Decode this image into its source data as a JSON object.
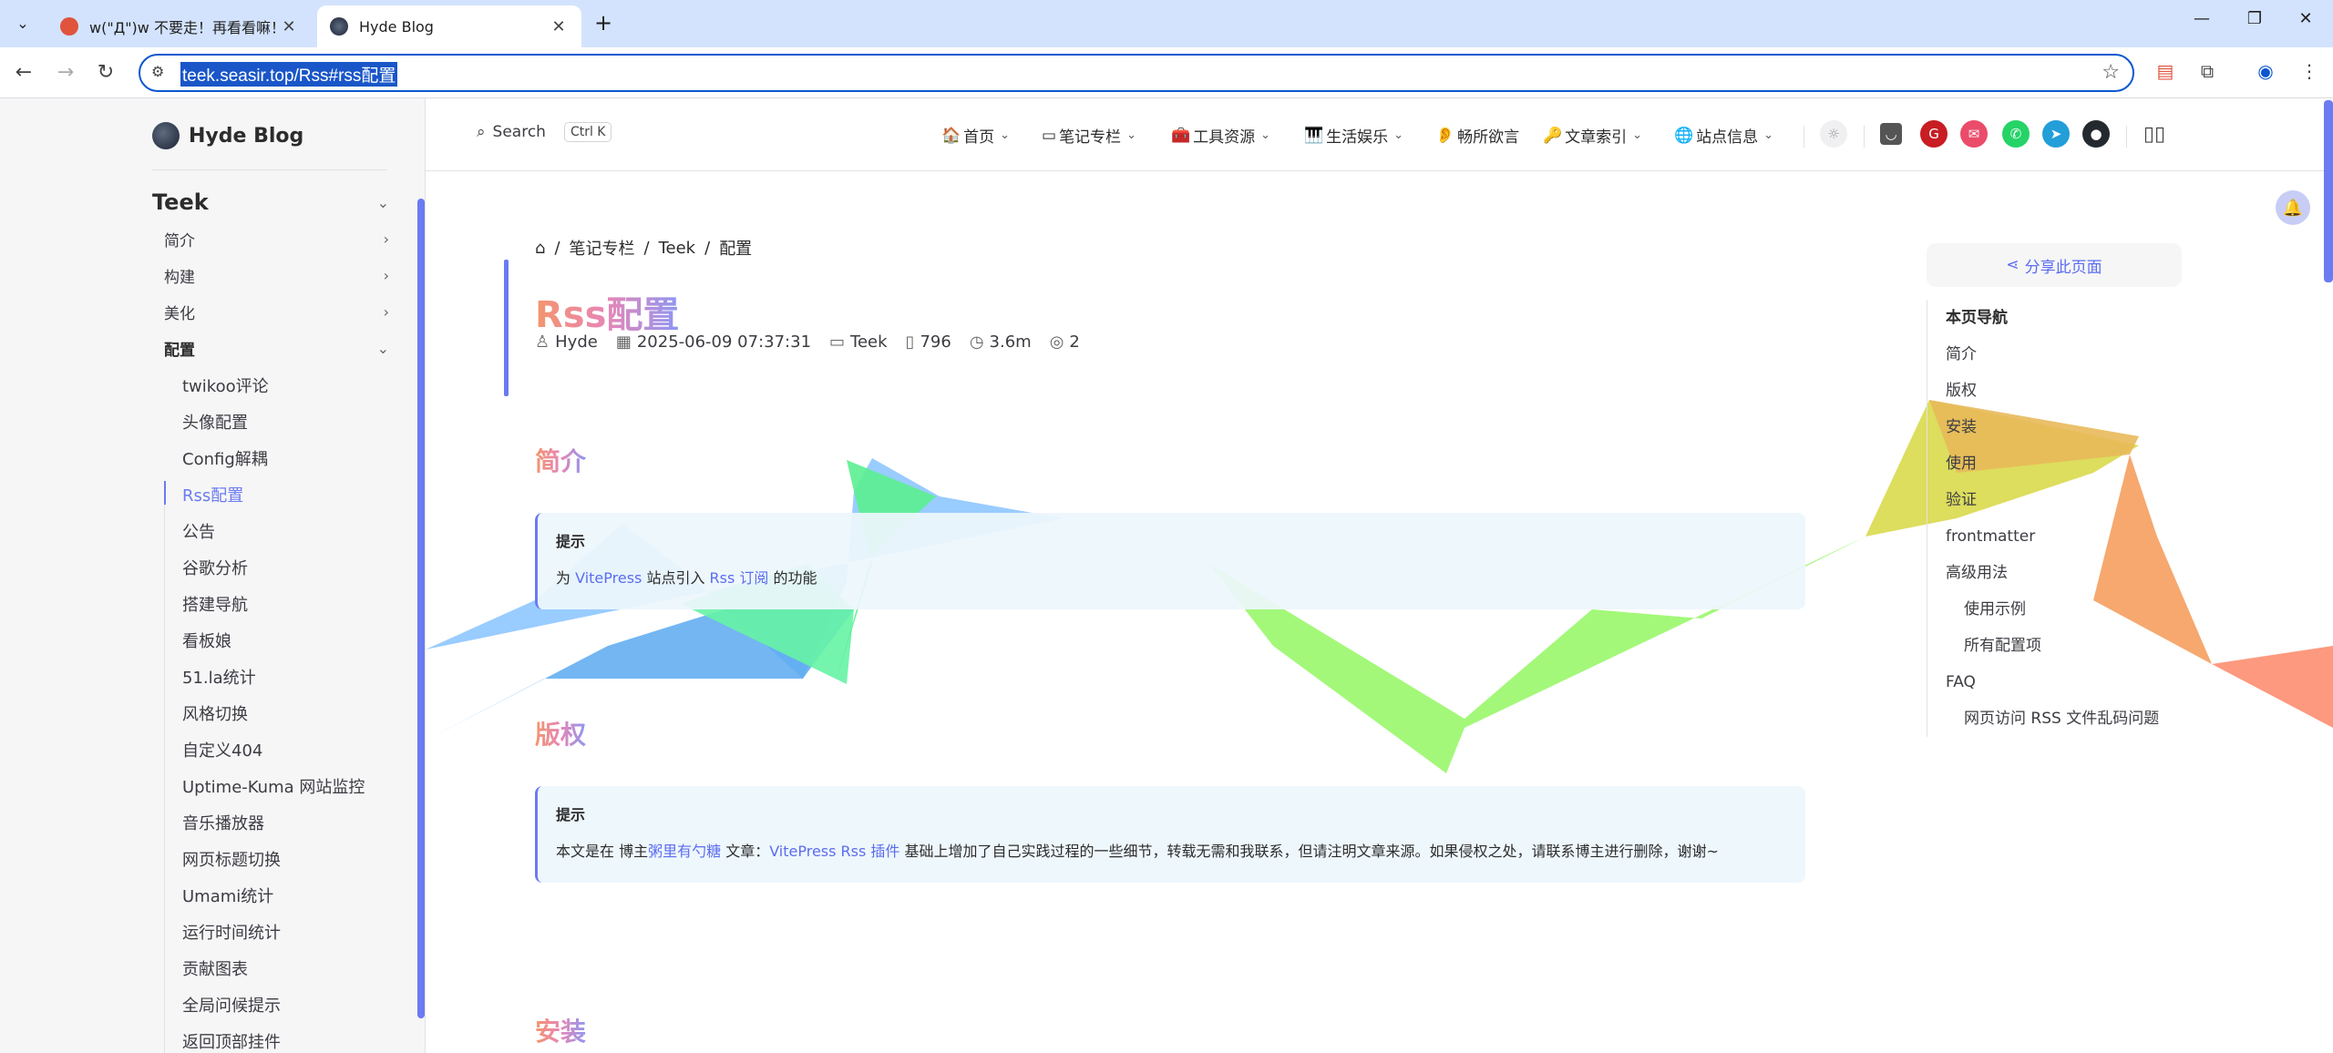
{
  "browser": {
    "tabs": [
      {
        "title": "w(\"Д\")w 不要走！再看看嘛！",
        "active": false
      },
      {
        "title": "Hyde Blog",
        "active": true
      }
    ],
    "url": "teek.seasir.top/Rss#rss配置",
    "window_controls": {
      "minimize": "—",
      "restore": "❐",
      "close": "✕"
    }
  },
  "site": {
    "logo_text": "Hyde Blog",
    "search_label": "Search",
    "search_shortcut": "Ctrl K",
    "nav": [
      {
        "icon": "🏠",
        "label": "首页",
        "dropdown": true
      },
      {
        "icon": "▭",
        "label": "笔记专栏",
        "dropdown": true
      },
      {
        "icon": "🧰",
        "label": "工具资源",
        "dropdown": true
      },
      {
        "icon": "🎹",
        "label": "生活娱乐",
        "dropdown": true
      },
      {
        "icon": "👂",
        "label": "畅所欲言",
        "dropdown": false
      },
      {
        "icon": "🔑",
        "label": "文章索引",
        "dropdown": true
      },
      {
        "icon": "🌐",
        "label": "站点信息",
        "dropdown": true
      }
    ],
    "social_icons": [
      "rss-icon",
      "gitee-icon",
      "mail-icon",
      "whatsapp-icon",
      "telegram-icon",
      "github-icon"
    ]
  },
  "sidebar": {
    "section": "Teek",
    "groups": [
      {
        "label": "简介",
        "open": false
      },
      {
        "label": "构建",
        "open": false
      },
      {
        "label": "美化",
        "open": false
      },
      {
        "label": "配置",
        "open": true
      }
    ],
    "items": [
      "twikoo评论",
      "头像配置",
      "Config解耦",
      "Rss配置",
      "公告",
      "谷歌分析",
      "搭建导航",
      "看板娘",
      "51.la统计",
      "风格切换",
      "自定义404",
      "Uptime-Kuma 网站监控",
      "音乐播放器",
      "网页标题切换",
      "Umami统计",
      "运行时间统计",
      "贡献图表",
      "全局问候提示",
      "返回顶部挂件"
    ],
    "active_item": "Rss配置"
  },
  "article": {
    "breadcrumb": [
      "笔记专栏",
      "Teek",
      "配置"
    ],
    "title": "Rss配置",
    "meta": {
      "author": "Hyde",
      "date": "2025-06-09 07:37:31",
      "category": "Teek",
      "words": "796",
      "read_time": "3.6m",
      "views": "2"
    },
    "sections": [
      {
        "heading": "简介",
        "tip_title": "提示",
        "tip_parts": [
          "为 ",
          "VitePress",
          " 站点引入 ",
          "Rss 订阅",
          " 的功能"
        ]
      },
      {
        "heading": "版权",
        "tip_title": "提示",
        "tip_parts": [
          "本文是在 博主",
          "粥里有勺糖",
          " 文章：",
          "VitePress Rss 插件",
          " 基础上增加了自己实践过程的一些细节，转载无需和我联系，但请注明文章来源。如果侵权之处，请联系博主进行删除，谢谢~"
        ]
      },
      {
        "heading": "安装"
      }
    ]
  },
  "outline": {
    "share_label": "分享此页面",
    "title": "本页导航",
    "items": [
      {
        "label": "简介",
        "sub": false
      },
      {
        "label": "版权",
        "sub": false
      },
      {
        "label": "安装",
        "sub": false
      },
      {
        "label": "使用",
        "sub": false
      },
      {
        "label": "验证",
        "sub": false
      },
      {
        "label": "frontmatter",
        "sub": false
      },
      {
        "label": "高级用法",
        "sub": false
      },
      {
        "label": "使用示例",
        "sub": true
      },
      {
        "label": "所有配置项",
        "sub": true
      },
      {
        "label": "FAQ",
        "sub": false
      },
      {
        "label": "网页访问 RSS 文件乱码问题",
        "sub": true
      }
    ]
  },
  "colors": {
    "accent": "#6b7bf0",
    "tip_bg": "#edf6fc",
    "sidebar_bg": "#f6f6f7"
  }
}
